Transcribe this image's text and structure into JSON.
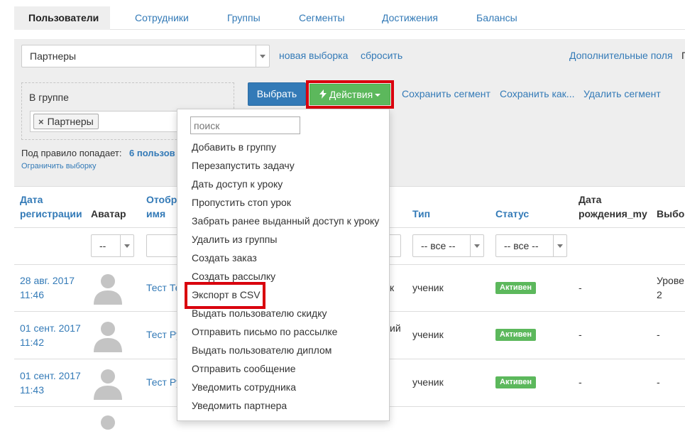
{
  "tabs": [
    "Пользователи",
    "Сотрудники",
    "Группы",
    "Сегменты",
    "Достижения",
    "Балансы"
  ],
  "filter": {
    "segment_select_value": "Партнеры",
    "new_selection": "новая выборка",
    "reset": "сбросить",
    "extra_fields": "Дополнительные поля",
    "extra_fields_cut": "Г",
    "group_label": "В группе",
    "group_tag": "Партнеры",
    "tag_remove": "×",
    "select_button": "Выбрать",
    "actions_button": "Действия",
    "actions_icon": "lightning-icon",
    "save_segment": "Сохранить сегмент",
    "save_as": "Сохранить как...",
    "delete_segment": "Удалить сегмент",
    "rule_text": "Под правило попадает:",
    "rule_count": "6 пользов",
    "limit_selection": "Ограничить выборку"
  },
  "table": {
    "headers": {
      "reg_date_1": "Дата",
      "reg_date_2": "регистрации",
      "avatar": "Аватар",
      "display_name_1": "Отобр",
      "display_name_2": "имя",
      "type": "Тип",
      "status": "Статус",
      "birthday_1": "Дата",
      "birthday_2": "рождения_my",
      "choice": "Выбор"
    },
    "filters": {
      "avatar": "--",
      "type": "-- все --",
      "status": "-- все --"
    },
    "rows": [
      {
        "date_1": "28 авг. 2017",
        "date_2": "11:46",
        "name": "Тест Те",
        "hidden_tail": "к",
        "type": "ученик",
        "status": "Активен",
        "birthday": "-",
        "choice_1": "Урове",
        "choice_2": "2"
      },
      {
        "date_1": "01 сент. 2017",
        "date_2": "11:42",
        "name": "Тест Ру",
        "hidden_tail": "ий",
        "type": "ученик",
        "status": "Активен",
        "birthday": "-",
        "choice_1": "-",
        "choice_2": ""
      },
      {
        "date_1": "01 сент. 2017",
        "date_2": "11:43",
        "name": "Тест Ру",
        "hidden_tail": "",
        "type": "ученик",
        "status": "Активен",
        "birthday": "-",
        "choice_1": "-",
        "choice_2": ""
      }
    ]
  },
  "dropdown": {
    "search_placeholder": "поиск",
    "items": [
      "Добавить в группу",
      "Перезапустить задачу",
      "Дать доступ к уроку",
      "Пропустить стоп урок",
      "Забрать ранее выданный доступ к уроку",
      "Удалить из группы",
      "Создать заказ",
      "Создать рассылку",
      "Экспорт в CSV",
      "Выдать пользователю скидку",
      "Отправить письмо по рассылке",
      "Выдать пользователю диплом",
      "Отправить сообщение",
      "Уведомить сотрудника",
      "Уведомить партнера"
    ]
  },
  "colors": {
    "link": "#337ab7",
    "primary": "#337ab7",
    "success": "#5cb85c",
    "highlight": "#d9000d",
    "panel": "#eeeeee"
  }
}
